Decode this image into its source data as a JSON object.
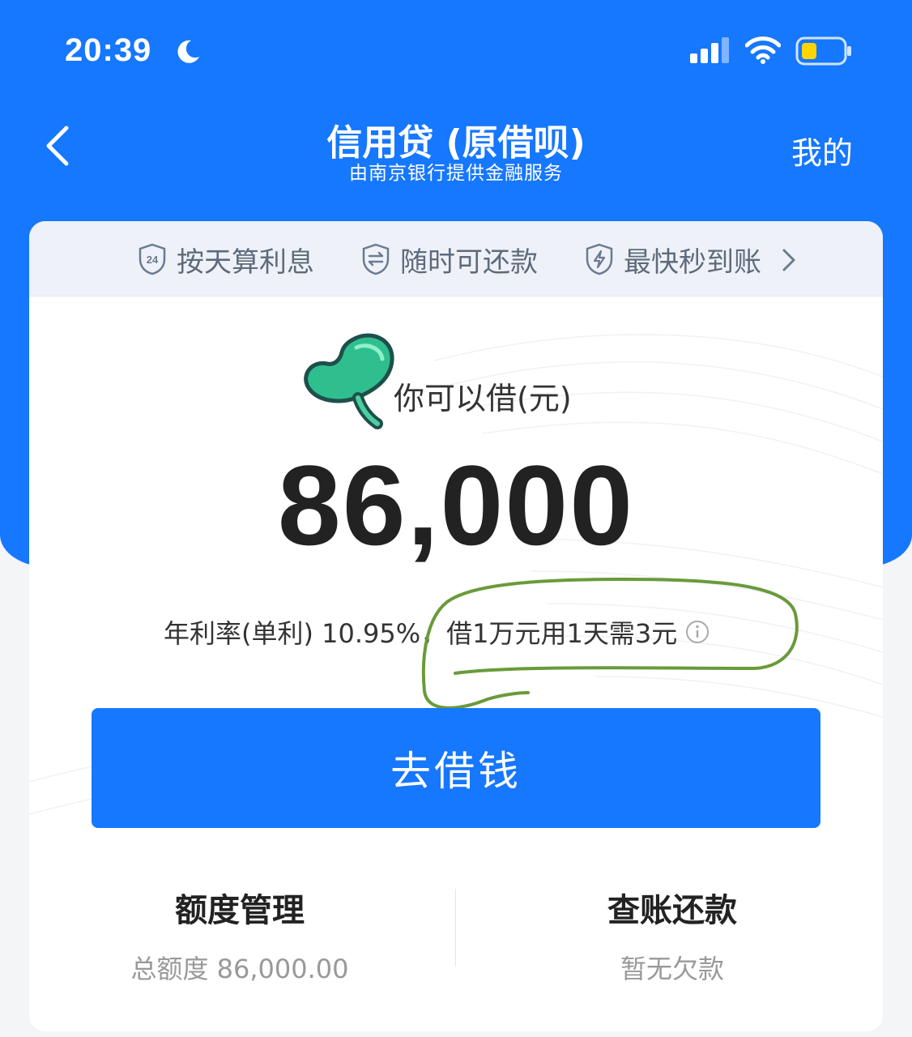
{
  "status_bar": {
    "time": "20:39"
  },
  "nav": {
    "title": "信用贷 (原借呗)",
    "subtitle": "由南京银行提供金融服务",
    "mine_label": "我的"
  },
  "features": [
    {
      "label": "按天算利息",
      "icon": "24-shield-icon"
    },
    {
      "label": "随时可还款",
      "icon": "exchange-shield-icon"
    },
    {
      "label": "最快秒到账",
      "icon": "lightning-shield-icon"
    }
  ],
  "loan": {
    "label": "你可以借(元)",
    "amount": "86,000",
    "rate_text": "年利率(单利) 10.95%，借1万元用1天需3元"
  },
  "borrow_button": {
    "label": "去借钱"
  },
  "bottom": {
    "quota_title": "额度管理",
    "quota_sub": "总额度 86,000.00",
    "bill_title": "查账还款",
    "bill_sub": "暂无欠款"
  },
  "colors": {
    "brand_blue": "#1677ff",
    "annotation_green": "#6a9a3a",
    "bean_green": "#2fbf8f"
  }
}
